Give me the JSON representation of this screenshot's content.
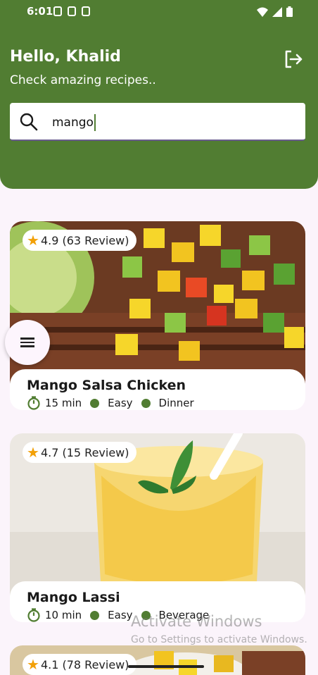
{
  "statusbar": {
    "time": "6:01"
  },
  "header": {
    "greeting": "Hello, Khalid",
    "subtitle": "Check amazing recipes..",
    "logout_icon": "logout-icon"
  },
  "search": {
    "value": "mango",
    "icon": "search-icon"
  },
  "colors": {
    "primary": "#517d32",
    "background": "#fbf4fb",
    "star": "#f2a007"
  },
  "recipes": [
    {
      "title": "Mango Salsa Chicken",
      "rating": "4.9",
      "reviews": "(63 Review)",
      "time": "15 min",
      "difficulty": "Easy",
      "category": "Dinner"
    },
    {
      "title": "Mango Lassi",
      "rating": "4.7",
      "reviews": "(15 Review)",
      "time": "10 min",
      "difficulty": "Easy",
      "category": "Beverage"
    },
    {
      "rating": "4.1",
      "reviews": "(78 Review)"
    }
  ],
  "watermark": {
    "line1": "Activate Windows",
    "line2": "Go to Settings to activate Windows."
  }
}
